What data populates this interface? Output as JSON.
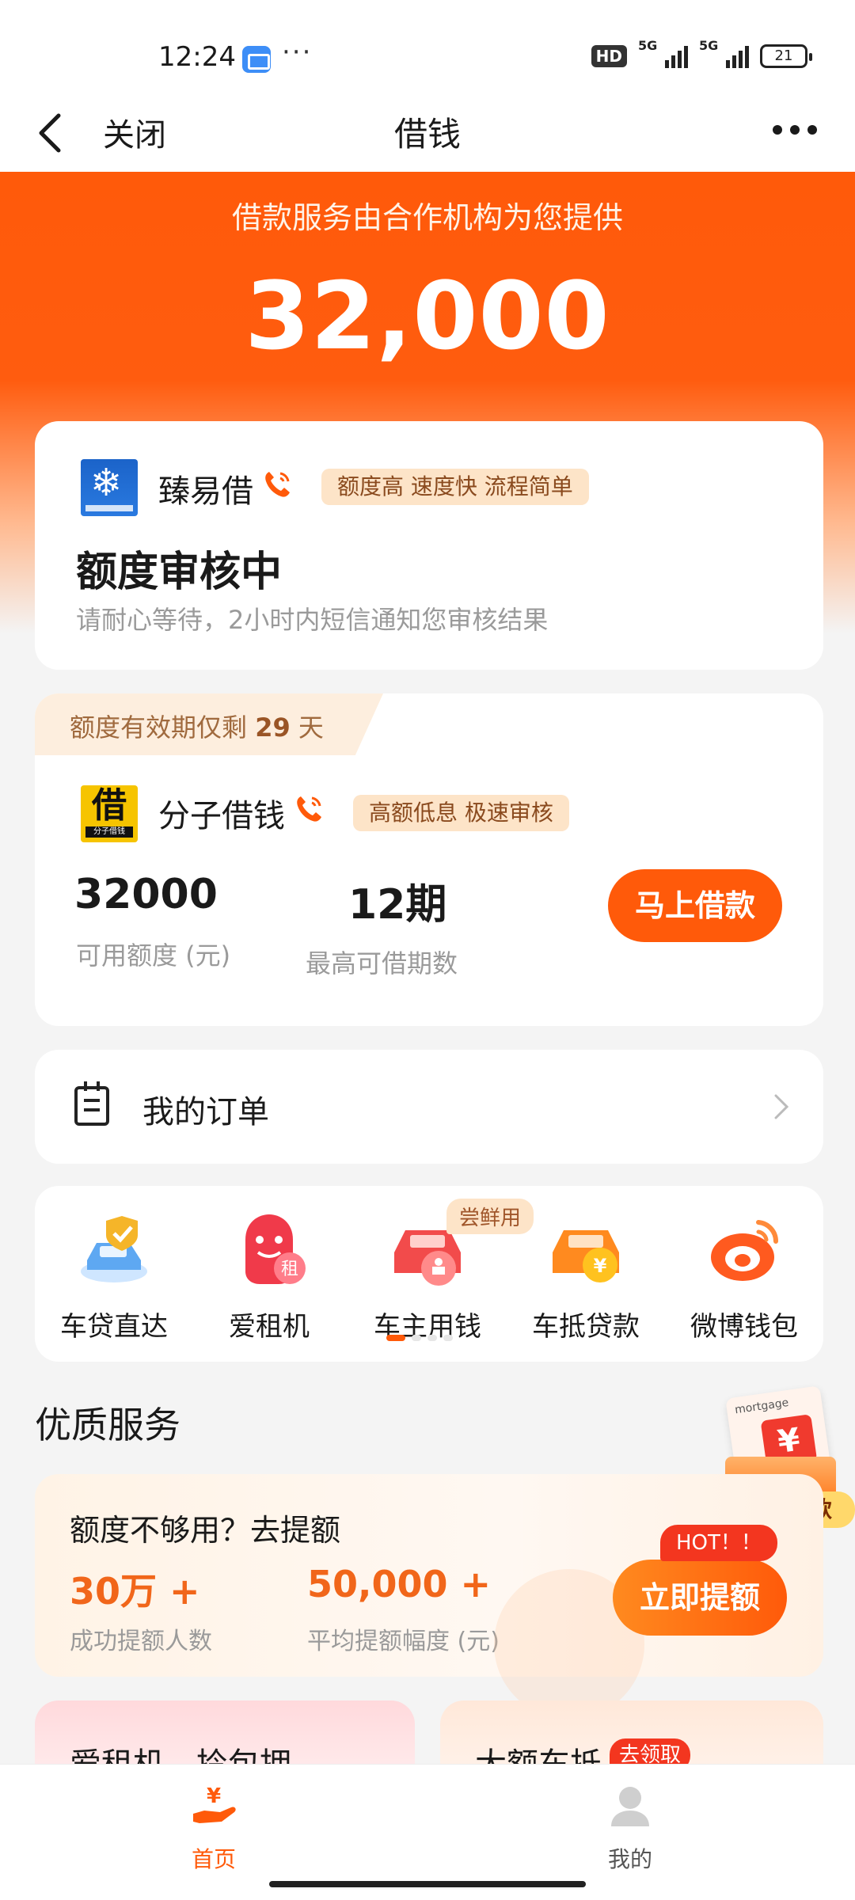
{
  "status_bar": {
    "time": "12:24",
    "dots": "···",
    "hd_label": "HD",
    "signal1_label": "5G",
    "signal2_label": "5G",
    "battery": "21"
  },
  "nav": {
    "close_label": "关闭",
    "title": "借钱"
  },
  "hero": {
    "subtitle": "借款服务由合作机构为您提供",
    "amount": "32,000"
  },
  "card_review": {
    "lender_name": "臻易借",
    "tag": "额度高 速度快 流程简单",
    "status_title": "额度审核中",
    "status_desc": "请耐心等待，2小时内短信通知您审核结果"
  },
  "card_offer": {
    "validity_prefix": "额度有效期仅剩",
    "validity_days": "29",
    "validity_suffix": "天",
    "logo_char": "借",
    "logo_caption": "分子借钱",
    "lender_name": "分子借钱",
    "tag": "高额低息 极速审核",
    "available_value": "32000",
    "available_label": "可用额度 (元)",
    "term_value": "12期",
    "term_label": "最高可借期数",
    "borrow_button": "马上借款"
  },
  "orders": {
    "label": "我的订单"
  },
  "services": {
    "items": [
      {
        "label": "车贷直达",
        "icon": "car-shield-icon"
      },
      {
        "label": "爱租机",
        "icon": "rent-phone-icon"
      },
      {
        "label": "车主用钱",
        "icon": "car-owner-icon"
      },
      {
        "label": "车抵贷款",
        "icon": "car-yen-icon"
      },
      {
        "label": "微博钱包",
        "icon": "weibo-icon"
      }
    ],
    "new_badge": "尝鲜用",
    "rent_char": "租"
  },
  "quality": {
    "section_title": "优质服务",
    "float_doc_text": "mortgage",
    "float_label": "大额贷款",
    "raise_title": "额度不够用？去提额",
    "stat1_value": "30万 +",
    "stat1_label": "成功提额人数",
    "stat2_value": "50,000 +",
    "stat2_label": "平均提额幅度 (元)",
    "hot_badge": "HOT！！",
    "raise_button": "立即提额"
  },
  "promo_cards": {
    "left_title": "爱租机　拎包拥",
    "right_title": "大额车抵",
    "right_badge": "去领取"
  },
  "tabbar": {
    "home_label": "首页",
    "mine_label": "我的"
  },
  "colors": {
    "brand_orange": "#ff5a0a",
    "tag_bg": "#fde4c8",
    "hot_red": "#f3361f"
  }
}
